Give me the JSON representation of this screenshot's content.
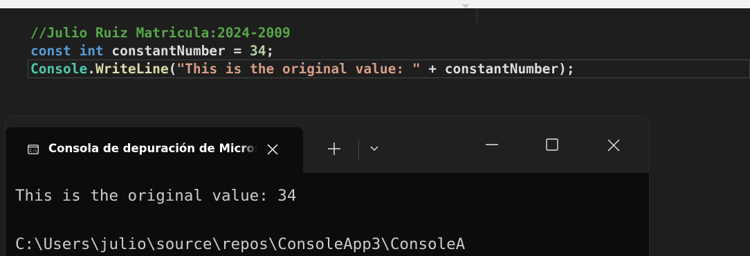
{
  "editor": {
    "code_lines": [
      {
        "tokens": [
          {
            "type": "comment",
            "text": "//Julio Ruiz Matricula:2024-2009"
          }
        ]
      },
      {
        "tokens": [
          {
            "type": "keyword",
            "text": "const"
          },
          {
            "type": "ident",
            "text": " "
          },
          {
            "type": "keyword",
            "text": "int"
          },
          {
            "type": "ident",
            "text": " constantNumber = "
          },
          {
            "type": "number",
            "text": "34"
          },
          {
            "type": "ident",
            "text": ";"
          }
        ]
      },
      {
        "tokens": [
          {
            "type": "class",
            "text": "Console"
          },
          {
            "type": "ident",
            "text": "."
          },
          {
            "type": "method",
            "text": "WriteLine"
          },
          {
            "type": "ident",
            "text": "("
          },
          {
            "type": "string",
            "text": "\"This is the original value: \""
          },
          {
            "type": "ident",
            "text": " + constantNumber);"
          }
        ]
      }
    ]
  },
  "terminal": {
    "tab_label": "Consola de depuración de Microsoft Visual Studio",
    "icon": "console-app-icon",
    "buttons": {
      "close_tab": "close-icon",
      "new_tab": "plus-icon",
      "dropdown": "chevron-down-icon",
      "minimize": "minimize-icon",
      "maximize": "maximize-icon",
      "close_window": "close-icon"
    },
    "output_lines": [
      "This is the original value: 34",
      "C:\\Users\\julio\\source\\repos\\ConsoleApp3\\ConsoleA"
    ]
  },
  "colors": {
    "editor_bg": "#1e1e1e",
    "terminal_bg": "#0c0c0c",
    "titlebar_bg": "#202020",
    "comment": "#57a64a",
    "keyword": "#569cd6",
    "class": "#4ec9b0",
    "method": "#dcdcaa",
    "string": "#d69d85",
    "number": "#b5cea8"
  }
}
